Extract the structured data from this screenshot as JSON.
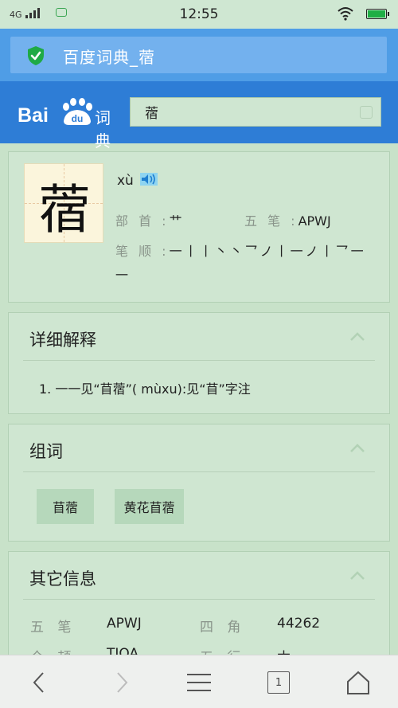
{
  "status_bar": {
    "network": "4G",
    "time": "12:55"
  },
  "address_bar": {
    "title": "百度词典_蓿",
    "secure_icon": "shield-check-icon"
  },
  "header": {
    "logo_text": "Bai",
    "logo_paw_text": "du",
    "logo_suffix": "词典",
    "search_value": "蓿"
  },
  "entry": {
    "character": "蓿",
    "pinyin": "xù",
    "radical_label": "部 首 :",
    "radical": "艹",
    "wubi_label": "五 笔 :",
    "wubi": "APWJ",
    "strokes_label": "笔 顺 :",
    "strokes": "一丨丨丶丶乛ノ丨一ノ丨乛一一"
  },
  "detail": {
    "title": "详细解释",
    "definitions": [
      "1.  一一见“苜蓿”( mùxu):见“苜”字注"
    ]
  },
  "words": {
    "title": "组词",
    "items": [
      "苜蓿",
      "黄花苜蓿"
    ]
  },
  "other": {
    "title": "其它信息",
    "rows": [
      {
        "label1": "五 笔",
        "value1": "APWJ",
        "label2": "四 角",
        "value2": "44262"
      },
      {
        "label1": "仓 颉",
        "value1": "TJOA",
        "label2": "五 行",
        "value2": "木"
      }
    ]
  },
  "bottom_nav": {
    "tab_count": "1"
  },
  "colors": {
    "page_bg": "#c8e2c9",
    "address_bar": "#4f9de6",
    "header": "#2e7dd6"
  }
}
